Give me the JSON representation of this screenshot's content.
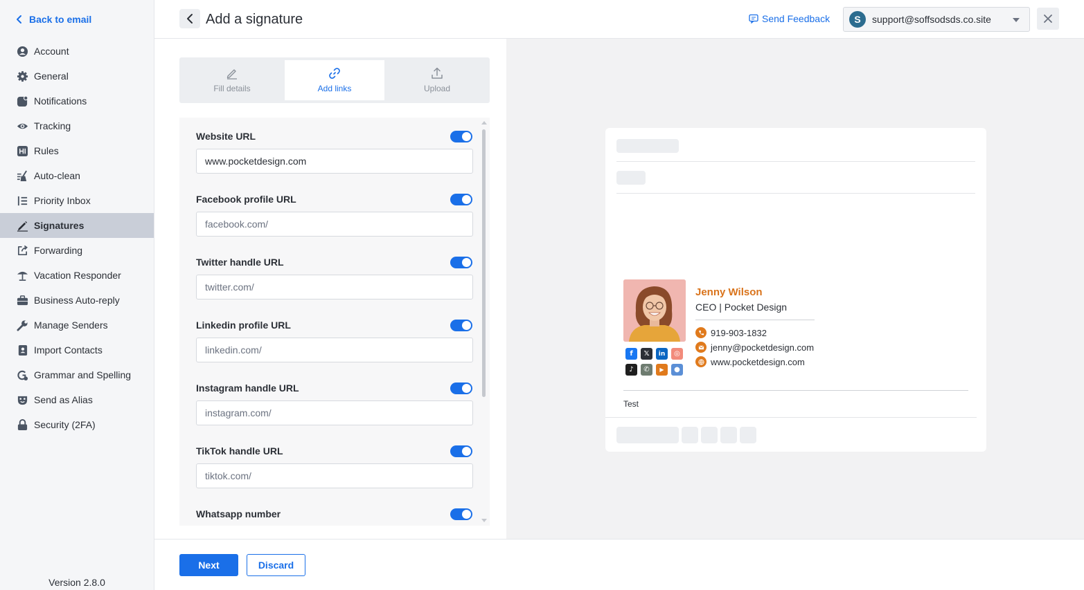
{
  "sidebar": {
    "back_label": "Back to email",
    "items": [
      {
        "label": "Account",
        "icon": "account-icon"
      },
      {
        "label": "General",
        "icon": "gear-icon"
      },
      {
        "label": "Notifications",
        "icon": "bell-icon"
      },
      {
        "label": "Tracking",
        "icon": "eye-icon"
      },
      {
        "label": "Rules",
        "icon": "rules-icon"
      },
      {
        "label": "Auto-clean",
        "icon": "broom-icon"
      },
      {
        "label": "Priority Inbox",
        "icon": "list-icon"
      },
      {
        "label": "Signatures",
        "icon": "pen-icon",
        "active": true
      },
      {
        "label": "Forwarding",
        "icon": "forward-icon"
      },
      {
        "label": "Vacation Responder",
        "icon": "umbrella-icon"
      },
      {
        "label": "Business Auto-reply",
        "icon": "briefcase-icon"
      },
      {
        "label": "Manage Senders",
        "icon": "wrench-icon"
      },
      {
        "label": "Import Contacts",
        "icon": "contacts-icon"
      },
      {
        "label": "Grammar and Spelling",
        "icon": "grammar-icon"
      },
      {
        "label": "Send as Alias",
        "icon": "mask-icon"
      },
      {
        "label": "Security (2FA)",
        "icon": "lock-icon"
      }
    ],
    "version": "Version 2.8.0"
  },
  "header": {
    "title": "Add a signature",
    "feedback_label": "Send Feedback",
    "account_initial": "S",
    "account_email": "support@soffsodsds.co.site"
  },
  "tabs": [
    {
      "label": "Fill details",
      "icon": "pencil-icon"
    },
    {
      "label": "Add links",
      "icon": "link-icon",
      "active": true
    },
    {
      "label": "Upload",
      "icon": "upload-icon"
    }
  ],
  "fields": [
    {
      "label": "Website URL",
      "value": "www.pocketdesign.com",
      "placeholder": "",
      "enabled": true
    },
    {
      "label": "Facebook profile URL",
      "value": "",
      "placeholder": "facebook.com/",
      "enabled": true
    },
    {
      "label": "Twitter handle URL",
      "value": "",
      "placeholder": "twitter.com/",
      "enabled": true
    },
    {
      "label": "Linkedin profile URL",
      "value": "",
      "placeholder": "linkedin.com/",
      "enabled": true
    },
    {
      "label": "Instagram handle URL",
      "value": "",
      "placeholder": "instagram.com/",
      "enabled": true
    },
    {
      "label": "TikTok handle URL",
      "value": "",
      "placeholder": "tiktok.com/",
      "enabled": true
    },
    {
      "label": "Whatsapp number",
      "value": "",
      "placeholder": "",
      "enabled": true
    }
  ],
  "signature": {
    "name": "Jenny Wilson",
    "role": "CEO | Pocket Design",
    "phone": "919-903-1832",
    "email": "jenny@pocketdesign.com",
    "website": "www.pocketdesign.com",
    "footer_text": "Test",
    "accent_color": "#d9731b",
    "social_icons": [
      "facebook-icon",
      "x-icon",
      "linkedin-icon",
      "instagram-icon",
      "tiktok-icon",
      "whatsapp-icon",
      "youtube-icon",
      "location-icon"
    ]
  },
  "footer": {
    "next_label": "Next",
    "discard_label": "Discard"
  },
  "colors": {
    "primary": "#1a6fe8",
    "active_nav": "#c9ced8"
  }
}
